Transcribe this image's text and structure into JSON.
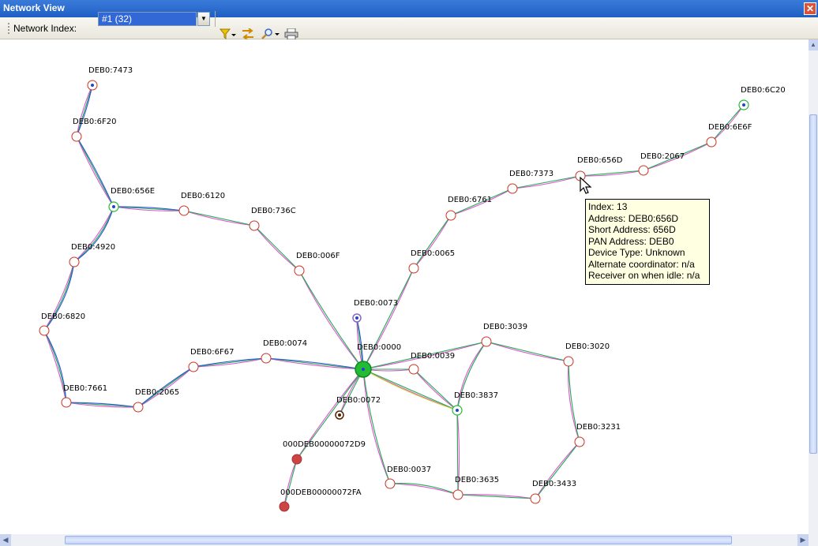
{
  "window": {
    "title": "Network View",
    "close_label": "✕"
  },
  "toolbar": {
    "network_index_label": "Network Index:",
    "network_index_value": "#1 (32)",
    "dropdown_glyph": "▼",
    "filter_icon": "⏷",
    "layout_icon": "⇆",
    "zoom_icon": "🔍",
    "zoom_dropdown_icon": "▾",
    "print_icon": "🖶"
  },
  "colors": {
    "route_green": "#22aa55",
    "route_pink": "#dd55cc",
    "route_blue": "#3355dd",
    "route_yellow": "#cccc33",
    "router_ring": "#cc3322",
    "coordinator": "#22bb33",
    "end_device_red": "#cc4444",
    "end_device_purple": "#8866cc",
    "end_device_brown": "#552200"
  },
  "nodes": [
    {
      "id": "n7473",
      "label": "DEB0:7473",
      "type": "end-blue"
    },
    {
      "id": "n6F20",
      "label": "DEB0:6F20",
      "type": "router"
    },
    {
      "id": "n656E",
      "label": "DEB0:656E",
      "type": "router-green"
    },
    {
      "id": "n6120",
      "label": "DEB0:6120",
      "type": "router"
    },
    {
      "id": "n736C",
      "label": "DEB0:736C",
      "type": "router"
    },
    {
      "id": "n006F",
      "label": "DEB0:006F",
      "type": "router"
    },
    {
      "id": "n4920",
      "label": "DEB0:4920",
      "type": "router"
    },
    {
      "id": "n6820",
      "label": "DEB0:6820",
      "type": "router"
    },
    {
      "id": "n7661",
      "label": "DEB0:7661",
      "type": "router"
    },
    {
      "id": "n2065",
      "label": "DEB0:2065",
      "type": "router"
    },
    {
      "id": "n6F67",
      "label": "DEB0:6F67",
      "type": "router"
    },
    {
      "id": "n0074",
      "label": "DEB0:0074",
      "type": "router"
    },
    {
      "id": "n0073",
      "label": "DEB0:0073",
      "type": "end-purple"
    },
    {
      "id": "n0000",
      "label": "DEB0:0000",
      "type": "coordinator"
    },
    {
      "id": "n0072",
      "label": "DEB0:0072",
      "type": "end-brown"
    },
    {
      "id": "n72D9",
      "label": "000DEB00000072D9",
      "type": "end-red"
    },
    {
      "id": "n72FA",
      "label": "000DEB00000072FA",
      "type": "end-red"
    },
    {
      "id": "n0065",
      "label": "DEB0:0065",
      "type": "router"
    },
    {
      "id": "n6761",
      "label": "DEB0:6761",
      "type": "router"
    },
    {
      "id": "n7373",
      "label": "DEB0:7373",
      "type": "router"
    },
    {
      "id": "n656D",
      "label": "DEB0:656D",
      "type": "router"
    },
    {
      "id": "n2067",
      "label": "DEB0:2067",
      "type": "router"
    },
    {
      "id": "n6E6F",
      "label": "DEB0:6E6F",
      "type": "router"
    },
    {
      "id": "n6C20",
      "label": "DEB0:6C20",
      "type": "router-green"
    },
    {
      "id": "n0039",
      "label": "DEB0:0039",
      "type": "router"
    },
    {
      "id": "n3039",
      "label": "DEB0:3039",
      "type": "router"
    },
    {
      "id": "n3020",
      "label": "DEB0:3020",
      "type": "router"
    },
    {
      "id": "n3837",
      "label": "DEB0:3837",
      "type": "router-green"
    },
    {
      "id": "n3231",
      "label": "DEB0:3231",
      "type": "router"
    },
    {
      "id": "n0037",
      "label": "DEB0:0037",
      "type": "router"
    },
    {
      "id": "n3635",
      "label": "DEB0:3635",
      "type": "router"
    },
    {
      "id": "n3433",
      "label": "DEB0:3433",
      "type": "router"
    }
  ],
  "links": [
    [
      "n7473",
      "n6F20"
    ],
    [
      "n6F20",
      "n656E"
    ],
    [
      "n656E",
      "n6120"
    ],
    [
      "n6120",
      "n736C"
    ],
    [
      "n736C",
      "n006F"
    ],
    [
      "n006F",
      "n0000"
    ],
    [
      "n656E",
      "n4920"
    ],
    [
      "n4920",
      "n6820"
    ],
    [
      "n6820",
      "n7661"
    ],
    [
      "n7661",
      "n2065"
    ],
    [
      "n2065",
      "n6F67"
    ],
    [
      "n6F67",
      "n0074"
    ],
    [
      "n0074",
      "n0000"
    ],
    [
      "n0073",
      "n0000"
    ],
    [
      "n0000",
      "n0072"
    ],
    [
      "n0000",
      "n72D9"
    ],
    [
      "n72D9",
      "n72FA"
    ],
    [
      "n0000",
      "n0065"
    ],
    [
      "n0065",
      "n6761"
    ],
    [
      "n6761",
      "n7373"
    ],
    [
      "n7373",
      "n656D"
    ],
    [
      "n656D",
      "n2067"
    ],
    [
      "n2067",
      "n6E6F"
    ],
    [
      "n6E6F",
      "n6C20"
    ],
    [
      "n0000",
      "n0039"
    ],
    [
      "n0000",
      "n3039"
    ],
    [
      "n0000",
      "n3837"
    ],
    [
      "n0039",
      "n3837"
    ],
    [
      "n3039",
      "n3837"
    ],
    [
      "n3039",
      "n3020"
    ],
    [
      "n3020",
      "n3231"
    ],
    [
      "n3231",
      "n3433"
    ],
    [
      "n3433",
      "n3635"
    ],
    [
      "n3635",
      "n3837"
    ],
    [
      "n0000",
      "n0037"
    ],
    [
      "n0037",
      "n3635"
    ]
  ],
  "tooltip": {
    "lines": [
      "Index: 13",
      "Address: DEB0:656D",
      "Short Address: 656D",
      "PAN Address: DEB0",
      "Device Type: Unknown",
      "Alternate coordinator: n/a",
      "Receiver on when idle: n/a"
    ]
  },
  "scroll": {
    "up": "▲",
    "down": "▼",
    "left": "◀",
    "right": "▶",
    "corner": "▾"
  }
}
